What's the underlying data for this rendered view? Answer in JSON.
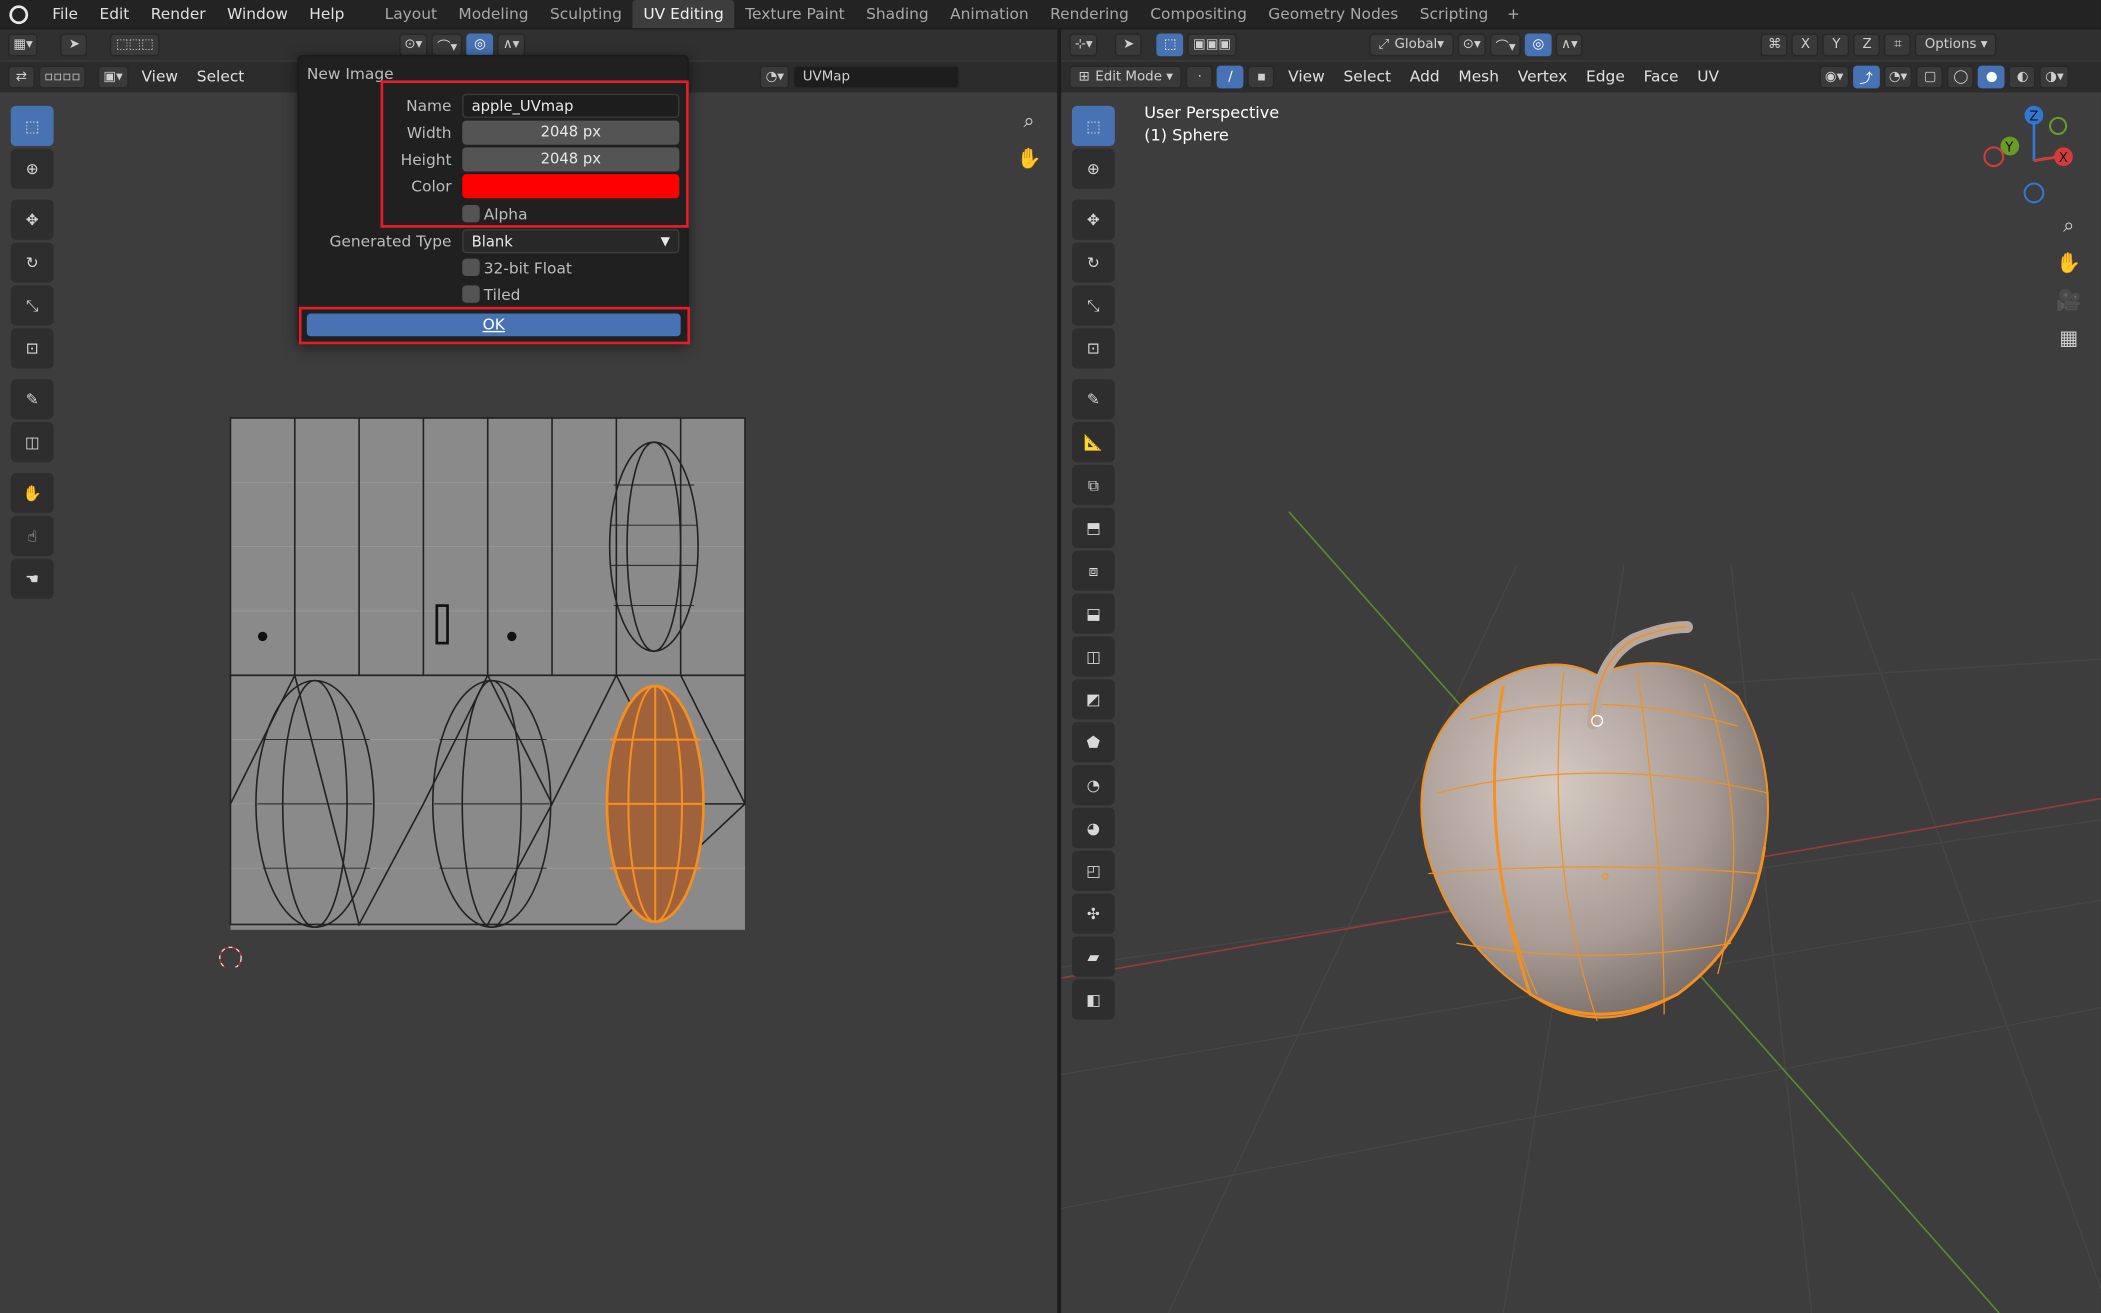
{
  "menu": {
    "items": [
      "File",
      "Edit",
      "Render",
      "Window",
      "Help"
    ]
  },
  "workspaces": {
    "tabs": [
      "Layout",
      "Modeling",
      "Sculpting",
      "UV Editing",
      "Texture Paint",
      "Shading",
      "Animation",
      "Rendering",
      "Compositing",
      "Geometry Nodes",
      "Scripting"
    ],
    "active": "UV Editing"
  },
  "uv_editor": {
    "menus": [
      "View",
      "Select"
    ],
    "uvmap_field": "UVMap"
  },
  "new_image_dialog": {
    "title": "New Image",
    "name_label": "Name",
    "name_value": "apple_UVmap",
    "width_label": "Width",
    "width_value": "2048 px",
    "height_label": "Height",
    "height_value": "2048 px",
    "color_label": "Color",
    "color_value": "#ff0000",
    "alpha_label": "Alpha",
    "generated_type_label": "Generated Type",
    "generated_type_value": "Blank",
    "float_label": "32-bit Float",
    "tiled_label": "Tiled",
    "ok_label": "OK"
  },
  "viewport": {
    "transform_orientation": "Global",
    "mode": "Edit Mode",
    "menus": [
      "View",
      "Select",
      "Add",
      "Mesh",
      "Vertex",
      "Edge",
      "Face",
      "UV"
    ],
    "options_label": "Options",
    "axis_buttons": [
      "X",
      "Y",
      "Z"
    ],
    "perspective_label": "User Perspective",
    "object_label": "(1) Sphere",
    "gizmo_axes": [
      "Z",
      "Y",
      "X"
    ]
  },
  "colors": {
    "accent": "#4772b3",
    "highlight": "#e41e26",
    "selection": "#f5901e",
    "color_field": "#ff0000"
  }
}
